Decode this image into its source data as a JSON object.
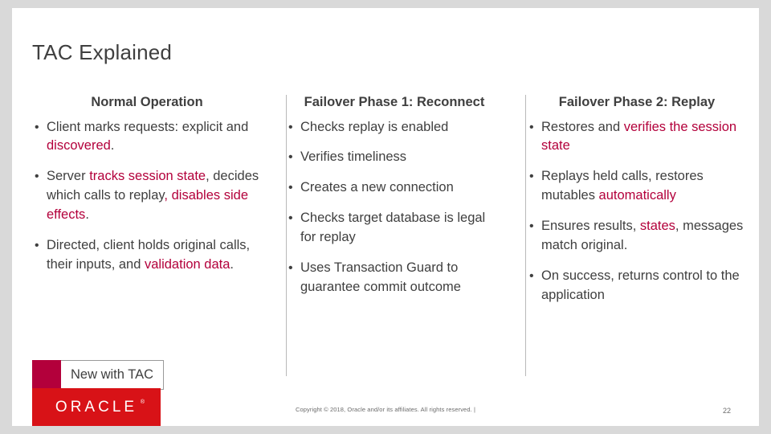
{
  "slide": {
    "title": "TAC Explained",
    "columns": [
      {
        "heading": "Normal Operation",
        "bullets": [
          [
            {
              "t": "Client marks requests: explicit and ",
              "hl": false
            },
            {
              "t": "discovered",
              "hl": true
            },
            {
              "t": ".",
              "hl": false
            }
          ],
          [
            {
              "t": "Server ",
              "hl": false
            },
            {
              "t": "tracks session state",
              "hl": true
            },
            {
              "t": ", decides which calls to replay",
              "hl": false
            },
            {
              "t": ",",
              "hl": true
            },
            {
              "t": " ",
              "hl": false
            },
            {
              "t": "disables side effects",
              "hl": true
            },
            {
              "t": ".",
              "hl": false
            }
          ],
          [
            {
              "t": "Directed, client holds original calls, their inputs, and ",
              "hl": false
            },
            {
              "t": "validation data",
              "hl": true
            },
            {
              "t": ".",
              "hl": false
            }
          ]
        ]
      },
      {
        "heading": "Failover Phase 1: Reconnect",
        "bullets": [
          [
            {
              "t": "Checks replay is enabled",
              "hl": false
            }
          ],
          [
            {
              "t": "Verifies timeliness",
              "hl": false
            }
          ],
          [
            {
              "t": "Creates a new connection",
              "hl": false
            }
          ],
          [
            {
              "t": "Checks target database is legal for replay",
              "hl": false
            }
          ],
          [
            {
              "t": "Uses Transaction Guard to guarantee commit outcome",
              "hl": false
            }
          ]
        ]
      },
      {
        "heading": "Failover Phase 2: Replay",
        "bullets": [
          [
            {
              "t": "Restores and ",
              "hl": false
            },
            {
              "t": "verifies the session state",
              "hl": true
            }
          ],
          [
            {
              "t": "Replays held calls, restores mutables ",
              "hl": false
            },
            {
              "t": "automatically",
              "hl": true
            }
          ],
          [
            {
              "t": "Ensures results, ",
              "hl": false
            },
            {
              "t": "states",
              "hl": true
            },
            {
              "t": ", messages match original.",
              "hl": false
            }
          ],
          [
            {
              "t": "On success, returns control to the application",
              "hl": false
            }
          ]
        ]
      }
    ],
    "legend": {
      "label": "New with TAC",
      "swatch_color": "#b3003b"
    },
    "footer": {
      "logo": "ORACLE",
      "logo_trademark": "®",
      "copyright": "Copyright © 2018, Oracle and/or its affiliates. All rights reserved.  |",
      "page_number": "22"
    }
  }
}
